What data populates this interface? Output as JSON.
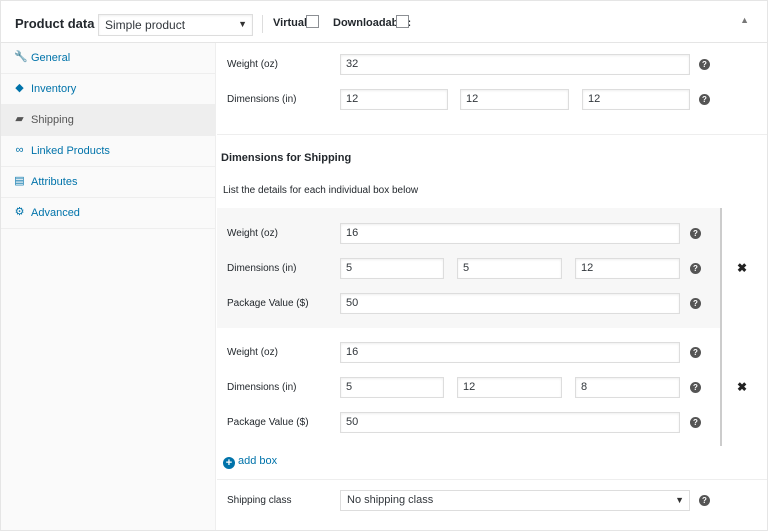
{
  "header": {
    "title": "Product data —",
    "product_type": "Simple product",
    "virtual_label": "Virtual:",
    "downloadable_label": "Downloadable:",
    "collapse_icon": "triangle-up-icon"
  },
  "sidebar": {
    "items": [
      {
        "label": "General",
        "icon": "wrench-icon"
      },
      {
        "label": "Inventory",
        "icon": "tag-icon"
      },
      {
        "label": "Shipping",
        "icon": "truck-icon"
      },
      {
        "label": "Linked Products",
        "icon": "link-icon"
      },
      {
        "label": "Attributes",
        "icon": "list-icon"
      },
      {
        "label": "Advanced",
        "icon": "gear-icon"
      }
    ],
    "active": "Shipping"
  },
  "shipping": {
    "weight_label": "Weight (oz)",
    "weight_value": "32",
    "dimensions_label": "Dimensions (in)",
    "length": "12",
    "width": "12",
    "height": "12"
  },
  "boxes_section": {
    "title": "Dimensions for Shipping",
    "description": "List the details for each individual box below",
    "weight_label": "Weight (oz)",
    "dimensions_label": "Dimensions (in)",
    "value_label": "Package Value ($)",
    "boxes": [
      {
        "weight": "16",
        "length": "5",
        "width": "5",
        "height": "12",
        "value": "50"
      },
      {
        "weight": "16",
        "length": "5",
        "width": "12",
        "height": "8",
        "value": "50"
      }
    ],
    "add_label": "add box"
  },
  "shipping_class": {
    "label": "Shipping class",
    "value": "No shipping class"
  },
  "help_glyph": "?",
  "remove_glyph": "✖"
}
